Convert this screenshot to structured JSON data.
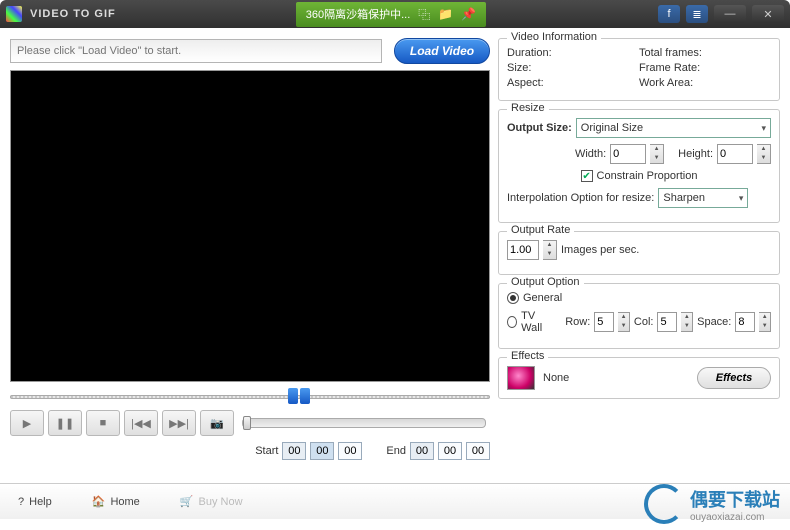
{
  "titlebar": {
    "title": "VIDEO TO GIF",
    "sandbox": "360隔离沙箱保护中..."
  },
  "path": {
    "placeholder": "Please click \"Load Video\" to start."
  },
  "load_label": "Load Video",
  "controls": {
    "play": "▶",
    "pause": "❚❚",
    "stop": "■",
    "prev": "|◀◀",
    "next": "▶▶|",
    "snap": "📷"
  },
  "time": {
    "start_label": "Start",
    "end_label": "End",
    "s1": "00",
    "s2": "00",
    "s3": "00",
    "e1": "00",
    "e2": "00",
    "e3": "00"
  },
  "info": {
    "title": "Video Information",
    "duration_l": "Duration:",
    "size_l": "Size:",
    "aspect_l": "Aspect:",
    "frames_l": "Total frames:",
    "rate_l": "Frame Rate:",
    "work_l": "Work Area:"
  },
  "resize": {
    "title": "Resize",
    "output_l": "Output Size:",
    "output_v": "Original Size",
    "width_l": "Width:",
    "width_v": "0",
    "height_l": "Height:",
    "height_v": "0",
    "constrain_l": "Constrain Proportion",
    "interp_l": "Interpolation Option for resize:",
    "interp_v": "Sharpen"
  },
  "rate": {
    "title": "Output Rate",
    "value": "1.00",
    "unit": "Images per sec."
  },
  "option": {
    "title": "Output Option",
    "general": "General",
    "tvwall": "TV Wall",
    "row_l": "Row:",
    "row_v": "5",
    "col_l": "Col:",
    "col_v": "5",
    "space_l": "Space:",
    "space_v": "8"
  },
  "fx": {
    "title": "Effects",
    "value": "None",
    "btn": "Effects"
  },
  "footer": {
    "help": "Help",
    "home": "Home",
    "buy": "Buy Now"
  },
  "watermark": {
    "main": "偶要下载站",
    "sub": "ouyaoxiazai.com"
  }
}
